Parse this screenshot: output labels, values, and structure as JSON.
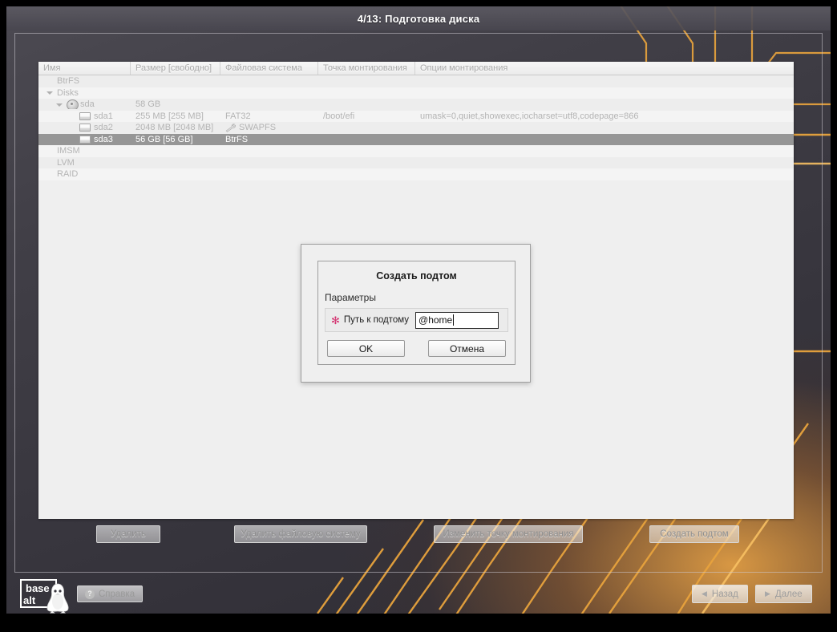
{
  "window": {
    "title": "4/13: Подготовка диска"
  },
  "table": {
    "headers": [
      "Имя",
      "Размер [свободно]",
      "Файловая система",
      "Точка монтирования",
      "Опции монтирования"
    ],
    "rows": [
      {
        "name": "BtrFS",
        "size": "",
        "fs": "",
        "mount": "",
        "options": "",
        "icon": "none",
        "indent": 1,
        "expander": false,
        "selected": false,
        "stripe": "alt"
      },
      {
        "name": "Disks",
        "size": "",
        "fs": "",
        "mount": "",
        "options": "",
        "icon": "none",
        "indent": 1,
        "expander": true,
        "selected": false,
        "stripe": "plain"
      },
      {
        "name": "sda",
        "size": "58 GB",
        "fs": "",
        "mount": "",
        "options": "",
        "icon": "disk-icon",
        "indent": 2,
        "expander": true,
        "selected": false,
        "stripe": "alt"
      },
      {
        "name": "sda1",
        "size": "255 MB [255 MB]",
        "fs": "FAT32",
        "mount": "/boot/efi",
        "options": "umask=0,quiet,showexec,iocharset=utf8,codepage=866",
        "icon": "partition-icon",
        "indent": 3,
        "expander": false,
        "selected": false,
        "stripe": "plain"
      },
      {
        "name": "sda2",
        "size": "2048 MB [2048 MB]",
        "fs": "SWAPFS",
        "mount": "",
        "options": "",
        "icon": "partition-icon",
        "fsIcon": "wrench-icon",
        "indent": 3,
        "expander": false,
        "selected": false,
        "stripe": "alt"
      },
      {
        "name": "sda3",
        "size": "56 GB [56 GB]",
        "fs": "BtrFS",
        "mount": "",
        "options": "",
        "icon": "partition-icon",
        "indent": 3,
        "expander": false,
        "selected": true,
        "stripe": "sel"
      },
      {
        "name": "IMSM",
        "size": "",
        "fs": "",
        "mount": "",
        "options": "",
        "icon": "none",
        "indent": 1,
        "expander": false,
        "selected": false,
        "stripe": "plain"
      },
      {
        "name": "LVM",
        "size": "",
        "fs": "",
        "mount": "",
        "options": "",
        "icon": "none",
        "indent": 1,
        "expander": false,
        "selected": false,
        "stripe": "alt"
      },
      {
        "name": "RAID",
        "size": "",
        "fs": "",
        "mount": "",
        "options": "",
        "icon": "none",
        "indent": 1,
        "expander": false,
        "selected": false,
        "stripe": "plain"
      }
    ]
  },
  "actions": {
    "delete": "Удалить",
    "delete_fs": "Удалить файловую систему",
    "change_mountpoint": "Изменить точку монтирования",
    "create_subvolume": "Создать подтом"
  },
  "dialog": {
    "title": "Создать подтом",
    "group_label": "Параметры",
    "required_marker": "✻",
    "field_label": "Путь к подтому",
    "field_value": "@home",
    "ok": "OK",
    "cancel": "Отмена"
  },
  "footer": {
    "logo_line1": "base",
    "logo_line2": "alt",
    "help": "Справка",
    "help_icon_glyph": "?",
    "back": "Назад",
    "next": "Далее",
    "back_chevron": "◀",
    "next_chevron": "▶"
  },
  "colors": {
    "accent_orange": "#e8a33d",
    "selection_gray": "#969696",
    "panel_bg": "#efefef",
    "required_star": "#d4316f",
    "title_bar": "#5c5a62"
  }
}
